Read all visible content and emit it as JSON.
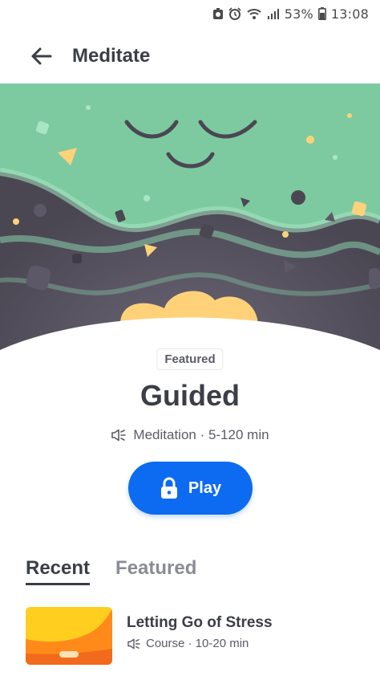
{
  "status_bar": {
    "battery_percent": "53%",
    "time": "13:08",
    "icons": [
      "silent-icon",
      "alarm-icon",
      "wifi-icon",
      "signal-icon",
      "battery-icon"
    ]
  },
  "app_bar": {
    "back_icon": "arrow-left-icon",
    "title": "Meditate"
  },
  "featured": {
    "badge": "Featured",
    "title": "Guided",
    "meta_icon": "speaker-icon",
    "meta": "Meditation · 5-120 min",
    "play_label": "Play",
    "play_icon": "lock-icon",
    "accent_color": "#0c6bf0"
  },
  "tabs": [
    {
      "label": "Recent",
      "active": true
    },
    {
      "label": "Featured",
      "active": false
    }
  ],
  "recent": [
    {
      "title": "Letting Go of Stress",
      "meta_icon": "speaker-icon",
      "meta": "Course · 10-20 min"
    }
  ],
  "colors": {
    "hero_green": "#7dcaa1",
    "hero_dark": "#4a4753",
    "hero_yellow": "#ffd27a"
  }
}
